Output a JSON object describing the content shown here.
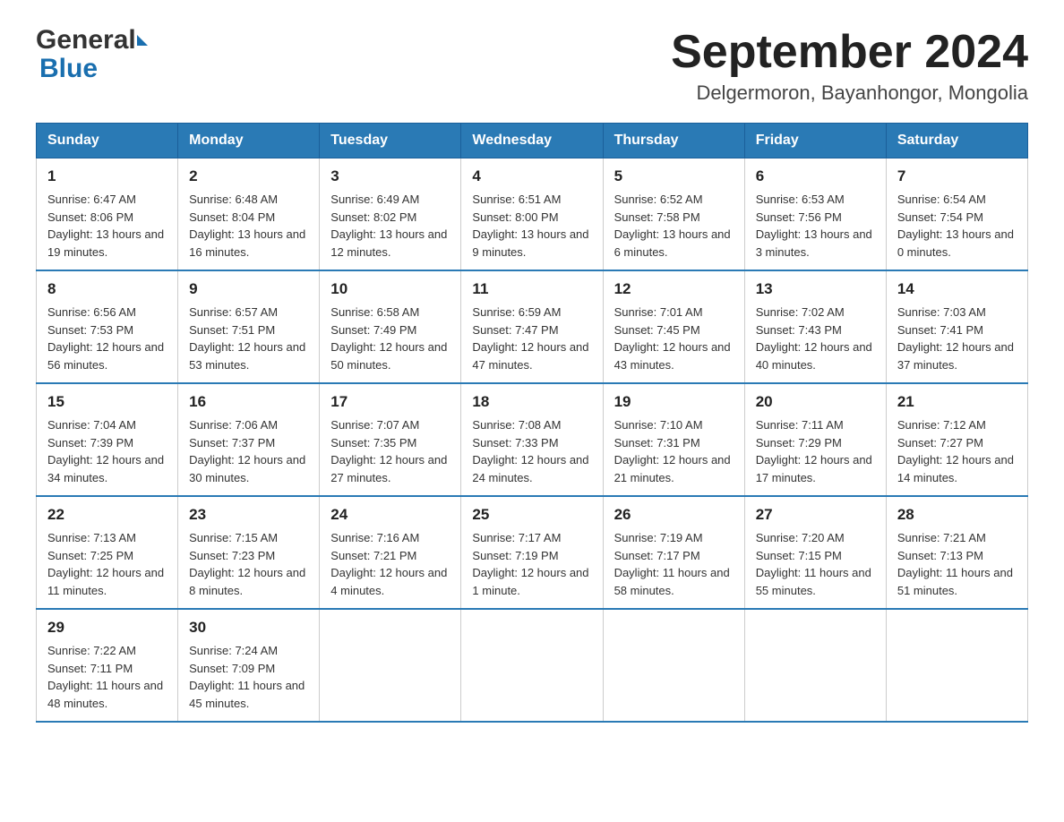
{
  "header": {
    "logo": {
      "general": "General",
      "blue": "Blue"
    },
    "title": "September 2024",
    "location": "Delgermoron, Bayanhongor, Mongolia"
  },
  "weekdays": [
    "Sunday",
    "Monday",
    "Tuesday",
    "Wednesday",
    "Thursday",
    "Friday",
    "Saturday"
  ],
  "weeks": [
    [
      {
        "day": "1",
        "sunrise": "6:47 AM",
        "sunset": "8:06 PM",
        "daylight": "13 hours and 19 minutes."
      },
      {
        "day": "2",
        "sunrise": "6:48 AM",
        "sunset": "8:04 PM",
        "daylight": "13 hours and 16 minutes."
      },
      {
        "day": "3",
        "sunrise": "6:49 AM",
        "sunset": "8:02 PM",
        "daylight": "13 hours and 12 minutes."
      },
      {
        "day": "4",
        "sunrise": "6:51 AM",
        "sunset": "8:00 PM",
        "daylight": "13 hours and 9 minutes."
      },
      {
        "day": "5",
        "sunrise": "6:52 AM",
        "sunset": "7:58 PM",
        "daylight": "13 hours and 6 minutes."
      },
      {
        "day": "6",
        "sunrise": "6:53 AM",
        "sunset": "7:56 PM",
        "daylight": "13 hours and 3 minutes."
      },
      {
        "day": "7",
        "sunrise": "6:54 AM",
        "sunset": "7:54 PM",
        "daylight": "13 hours and 0 minutes."
      }
    ],
    [
      {
        "day": "8",
        "sunrise": "6:56 AM",
        "sunset": "7:53 PM",
        "daylight": "12 hours and 56 minutes."
      },
      {
        "day": "9",
        "sunrise": "6:57 AM",
        "sunset": "7:51 PM",
        "daylight": "12 hours and 53 minutes."
      },
      {
        "day": "10",
        "sunrise": "6:58 AM",
        "sunset": "7:49 PM",
        "daylight": "12 hours and 50 minutes."
      },
      {
        "day": "11",
        "sunrise": "6:59 AM",
        "sunset": "7:47 PM",
        "daylight": "12 hours and 47 minutes."
      },
      {
        "day": "12",
        "sunrise": "7:01 AM",
        "sunset": "7:45 PM",
        "daylight": "12 hours and 43 minutes."
      },
      {
        "day": "13",
        "sunrise": "7:02 AM",
        "sunset": "7:43 PM",
        "daylight": "12 hours and 40 minutes."
      },
      {
        "day": "14",
        "sunrise": "7:03 AM",
        "sunset": "7:41 PM",
        "daylight": "12 hours and 37 minutes."
      }
    ],
    [
      {
        "day": "15",
        "sunrise": "7:04 AM",
        "sunset": "7:39 PM",
        "daylight": "12 hours and 34 minutes."
      },
      {
        "day": "16",
        "sunrise": "7:06 AM",
        "sunset": "7:37 PM",
        "daylight": "12 hours and 30 minutes."
      },
      {
        "day": "17",
        "sunrise": "7:07 AM",
        "sunset": "7:35 PM",
        "daylight": "12 hours and 27 minutes."
      },
      {
        "day": "18",
        "sunrise": "7:08 AM",
        "sunset": "7:33 PM",
        "daylight": "12 hours and 24 minutes."
      },
      {
        "day": "19",
        "sunrise": "7:10 AM",
        "sunset": "7:31 PM",
        "daylight": "12 hours and 21 minutes."
      },
      {
        "day": "20",
        "sunrise": "7:11 AM",
        "sunset": "7:29 PM",
        "daylight": "12 hours and 17 minutes."
      },
      {
        "day": "21",
        "sunrise": "7:12 AM",
        "sunset": "7:27 PM",
        "daylight": "12 hours and 14 minutes."
      }
    ],
    [
      {
        "day": "22",
        "sunrise": "7:13 AM",
        "sunset": "7:25 PM",
        "daylight": "12 hours and 11 minutes."
      },
      {
        "day": "23",
        "sunrise": "7:15 AM",
        "sunset": "7:23 PM",
        "daylight": "12 hours and 8 minutes."
      },
      {
        "day": "24",
        "sunrise": "7:16 AM",
        "sunset": "7:21 PM",
        "daylight": "12 hours and 4 minutes."
      },
      {
        "day": "25",
        "sunrise": "7:17 AM",
        "sunset": "7:19 PM",
        "daylight": "12 hours and 1 minute."
      },
      {
        "day": "26",
        "sunrise": "7:19 AM",
        "sunset": "7:17 PM",
        "daylight": "11 hours and 58 minutes."
      },
      {
        "day": "27",
        "sunrise": "7:20 AM",
        "sunset": "7:15 PM",
        "daylight": "11 hours and 55 minutes."
      },
      {
        "day": "28",
        "sunrise": "7:21 AM",
        "sunset": "7:13 PM",
        "daylight": "11 hours and 51 minutes."
      }
    ],
    [
      {
        "day": "29",
        "sunrise": "7:22 AM",
        "sunset": "7:11 PM",
        "daylight": "11 hours and 48 minutes."
      },
      {
        "day": "30",
        "sunrise": "7:24 AM",
        "sunset": "7:09 PM",
        "daylight": "11 hours and 45 minutes."
      },
      null,
      null,
      null,
      null,
      null
    ]
  ],
  "labels": {
    "sunrise": "Sunrise:",
    "sunset": "Sunset:",
    "daylight": "Daylight:"
  }
}
